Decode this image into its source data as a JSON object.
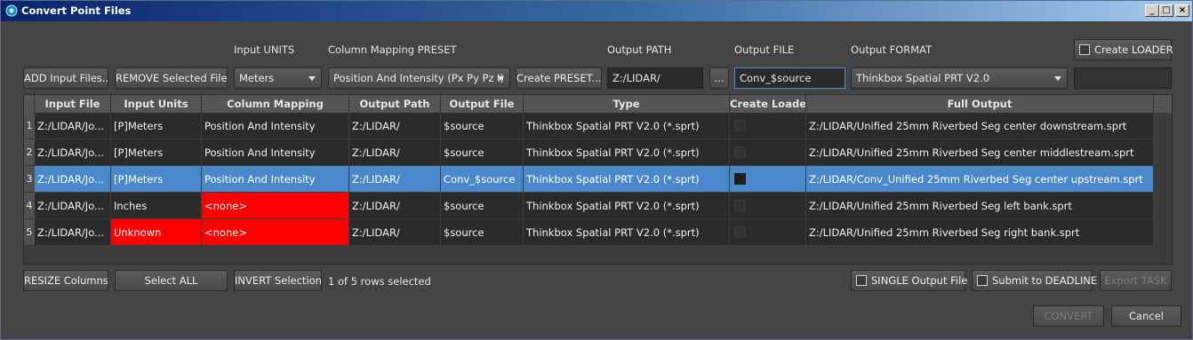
{
  "window": {
    "title": "Convert Point Files",
    "minimize": "_",
    "maximize": "□",
    "close": "×"
  },
  "labels": {
    "input_units": "Input UNITS",
    "column_mapping_preset": "Column Mapping PRESET",
    "output_path": "Output PATH",
    "output_file": "Output FILE",
    "output_format": "Output FORMAT"
  },
  "toolbar": {
    "add_input_files": "ADD Input Files...",
    "remove_selected_files": "REMOVE Selected Files",
    "units_value": "Meters",
    "preset_value": "Position And Intensity (Px Py Pz I)",
    "create_preset": "Create PRESET...",
    "output_path_value": "Z:/LIDAR/",
    "browse": "...",
    "output_file_value": "Conv_$source",
    "output_format_value": "Thinkbox Spatial PRT V2.0",
    "create_loader": "Create LOADER"
  },
  "table": {
    "columns": [
      "Input File",
      "Input Units",
      "Column Mapping",
      "Output Path",
      "Output File",
      "Type",
      "Create Loader",
      "Full Output"
    ],
    "rows": [
      {
        "n": "1",
        "input_file": "Z:/LIDAR/Jo...",
        "units": "[P]Meters",
        "mapping": "Position And Intensity",
        "path": "Z:/LIDAR/",
        "file": "$source",
        "type": "Thinkbox Spatial PRT V2.0 (*.sprt)",
        "full": "Z:/LIDAR/Unified 25mm Riverbed Seg center downstream.sprt"
      },
      {
        "n": "2",
        "input_file": "Z:/LIDAR/Jo...",
        "units": "[P]Meters",
        "mapping": "Position And Intensity",
        "path": "Z:/LIDAR/",
        "file": "$source",
        "type": "Thinkbox Spatial PRT V2.0 (*.sprt)",
        "full": "Z:/LIDAR/Unified 25mm Riverbed Seg center middlestream.sprt"
      },
      {
        "n": "3",
        "input_file": "Z:/LIDAR/Jo...",
        "units": "[P]Meters",
        "mapping": "Position And Intensity",
        "path": "Z:/LIDAR/",
        "file": "Conv_$source",
        "type": "Thinkbox Spatial PRT V2.0 (*.sprt)",
        "full": "Z:/LIDAR/Conv_Unified 25mm Riverbed Seg center upstream.sprt"
      },
      {
        "n": "4",
        "input_file": "Z:/LIDAR/Jo...",
        "units": "Inches",
        "mapping": "<none>",
        "path": "Z:/LIDAR/",
        "file": "$source",
        "type": "Thinkbox Spatial PRT V2.0 (*.sprt)",
        "full": "Z:/LIDAR/Unified 25mm Riverbed Seg left bank.sprt"
      },
      {
        "n": "5",
        "input_file": "Z:/LIDAR/Jo...",
        "units": "Unknown",
        "mapping": "<none>",
        "path": "Z:/LIDAR/",
        "file": "$source",
        "type": "Thinkbox Spatial PRT V2.0 (*.sprt)",
        "full": "Z:/LIDAR/Unified 25mm Riverbed Seg right bank.sprt"
      }
    ]
  },
  "bottom": {
    "resize_columns": "RESIZE Columns",
    "select_all": "Select ALL",
    "invert_selection": "INVERT Selection",
    "status": "1 of 5 rows selected",
    "single_output_file": "SINGLE Output File",
    "submit_to_deadline": "Submit to DEADLINE",
    "export_task": "Export TASK",
    "convert": "CONVERT",
    "cancel": "Cancel"
  },
  "colors": {
    "selected_row": "#4a88cc",
    "error_cell": "#ff0000",
    "titlebar": "#0a246a"
  }
}
